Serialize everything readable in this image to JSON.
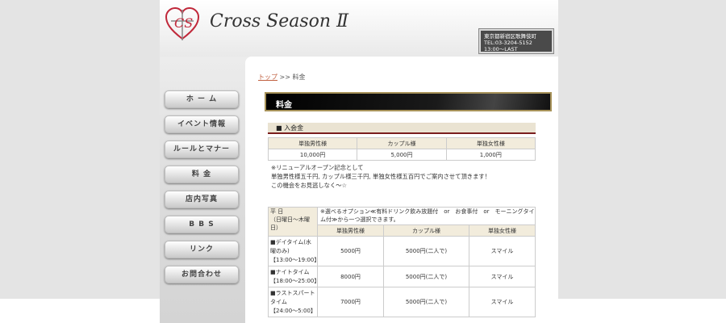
{
  "header": {
    "site_title": "Cross Season Ⅱ",
    "logo_letters": "CS",
    "contact": {
      "address": "東京都新宿区歌舞伎町",
      "tel": "TEL:03-3204-5152",
      "hours": "13:00～LAST"
    }
  },
  "nav": {
    "items": [
      {
        "label": "ホ ー ム"
      },
      {
        "label": "イベント情報"
      },
      {
        "label": "ルールとマナー"
      },
      {
        "label": "料 金"
      },
      {
        "label": "店内写真"
      },
      {
        "label": "B B S"
      },
      {
        "label": "リンク"
      },
      {
        "label": "お問合わせ"
      }
    ]
  },
  "breadcrumb": {
    "home": "トップ",
    "sep": " >> ",
    "current": "料金"
  },
  "page_title": "料金",
  "admission": {
    "heading": "■ 入会金",
    "columns": [
      "単独男性様",
      "カップル様",
      "単独女性様"
    ],
    "values": [
      "10,000円",
      "5,000円",
      "1,000円"
    ],
    "note_lines": [
      "※リニューアルオープン記念として",
      "単独男性様五千円, カップル様三千円, 単独女性様五百円でご案内させて頂きます！",
      "この機会をお見逃しなく～☆"
    ]
  },
  "weekday": {
    "label_lines": [
      "平 日",
      "（日曜日～木曜",
      "日）"
    ],
    "option_lines": [
      "※選べるオプション≪有料ドリンク飲み放題付　or　お食事付　or　モーニングタイ",
      "ム付≫から一つ選択できます。"
    ],
    "columns": [
      "単独男性様",
      "カップル様",
      "単独女性様"
    ],
    "rows": [
      {
        "label_lines": [
          "■デイタイム(水",
          "曜のみ)",
          "【13:00～19:00】"
        ],
        "values": [
          "5000円",
          "5000円(二人で)",
          "スマイル"
        ]
      },
      {
        "label_lines": [
          "■ナイトタイム",
          "【18:00～25:00】"
        ],
        "values": [
          "8000円",
          "5000円(二人で)",
          "スマイル"
        ]
      },
      {
        "label_lines": [
          "■ラストスパート",
          "タイム",
          "【24:00～5:00】"
        ],
        "values": [
          "7000円",
          "5000円(二人で)",
          "スマイル"
        ]
      }
    ]
  },
  "colors": {
    "accent": "#7a1e1e",
    "title_border": "#a8935a",
    "logo_red": "#c0283a"
  }
}
